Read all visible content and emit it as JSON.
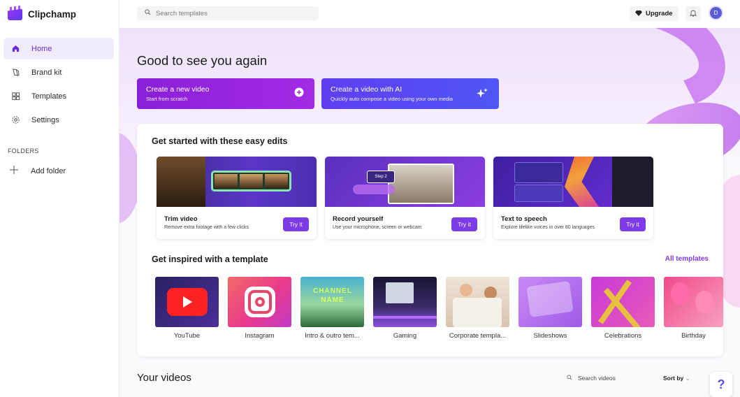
{
  "app": {
    "name": "Clipchamp"
  },
  "sidebar": {
    "items": [
      {
        "label": "Home",
        "icon": "home-icon",
        "active": true
      },
      {
        "label": "Brand kit",
        "icon": "brand-kit-icon"
      },
      {
        "label": "Templates",
        "icon": "templates-icon"
      },
      {
        "label": "Settings",
        "icon": "gear-icon"
      }
    ],
    "folders_label": "FOLDERS",
    "add_folder": "Add folder"
  },
  "topbar": {
    "search_placeholder": "Search templates",
    "upgrade_label": "Upgrade",
    "avatar_initial": "D"
  },
  "hero": {
    "greeting": "Good to see you again",
    "cta_new": {
      "title": "Create a new video",
      "subtitle": "Start from scratch"
    },
    "cta_ai": {
      "title": "Create a video with AI",
      "subtitle": "Quickly auto compose a video using your own media"
    }
  },
  "edits": {
    "heading": "Get started with these easy edits",
    "cards": [
      {
        "title": "Trim video",
        "desc": "Remove extra footage with a few clicks",
        "button": "Try it"
      },
      {
        "title": "Record yourself",
        "desc": "Use your microphone, screen or webcam",
        "button": "Try it",
        "thumb_label": "Step 2"
      },
      {
        "title": "Text to speech",
        "desc": "Explore lifelike voices in over 80 languages",
        "button": "Try it"
      }
    ]
  },
  "templates": {
    "heading": "Get inspired with a template",
    "all_label": "All templates",
    "channel_text": "CHANNEL NAME",
    "items": [
      {
        "label": "YouTube"
      },
      {
        "label": "Instagram"
      },
      {
        "label": "Intro & outro tem..."
      },
      {
        "label": "Gaming"
      },
      {
        "label": "Corporate templa..."
      },
      {
        "label": "Slideshows"
      },
      {
        "label": "Celebrations"
      },
      {
        "label": "Birthday"
      }
    ]
  },
  "videos": {
    "heading": "Your videos",
    "search_placeholder": "Search videos",
    "sort_label": "Sort by",
    "help": "?"
  },
  "colors": {
    "accent": "#7d3be8",
    "cta_purple": "#9a26e0",
    "cta_blue": "#5a48f3"
  }
}
